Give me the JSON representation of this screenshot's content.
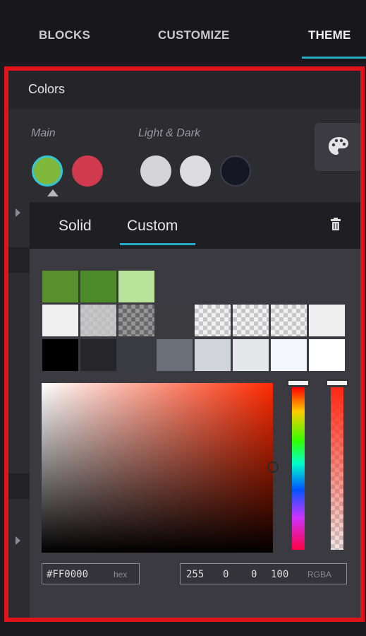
{
  "tabs": [
    {
      "label": "BLOCKS"
    },
    {
      "label": "CUSTOMIZE"
    },
    {
      "label": "THEME",
      "active": true
    }
  ],
  "colors_panel": {
    "title": "Colors",
    "groups": {
      "main_label": "Main",
      "light_dark_label": "Light & Dark"
    },
    "main_swatches": [
      "#7fb83a",
      "#d23a4f"
    ],
    "light_dark_swatches": [
      "#d4d4d8",
      "#dcdcdf",
      "#151724"
    ],
    "palette_icon": "palette-icon"
  },
  "picker": {
    "tabs": {
      "solid": "Solid",
      "custom": "Custom"
    },
    "active_tab": "Custom",
    "trash_icon": "trash-icon",
    "recent_swatches": [
      "#5a8f2e",
      "#4d8a2a",
      "#b9e39a"
    ],
    "grey_row": [
      "#f0f0f0",
      "checker-light",
      "checker-mid",
      "#3b3b3e",
      "checker",
      "checker",
      "checker",
      "#efefef"
    ],
    "dark_row": [
      "#000000",
      "#25252a",
      "#3a3b40",
      "#6b7078",
      "#d1d5db",
      "#e5e7eb",
      "#f3f6fb",
      "#ffffff"
    ],
    "hex": {
      "value": "#FF0000",
      "unit": "hex"
    },
    "rgba": {
      "r": "255",
      "g": "0",
      "b": "0",
      "a": "100",
      "unit": "RGBA"
    },
    "hue_color": "#ff0000"
  },
  "accent_color": "#27a9c1",
  "highlight_border_color": "#e1131a"
}
